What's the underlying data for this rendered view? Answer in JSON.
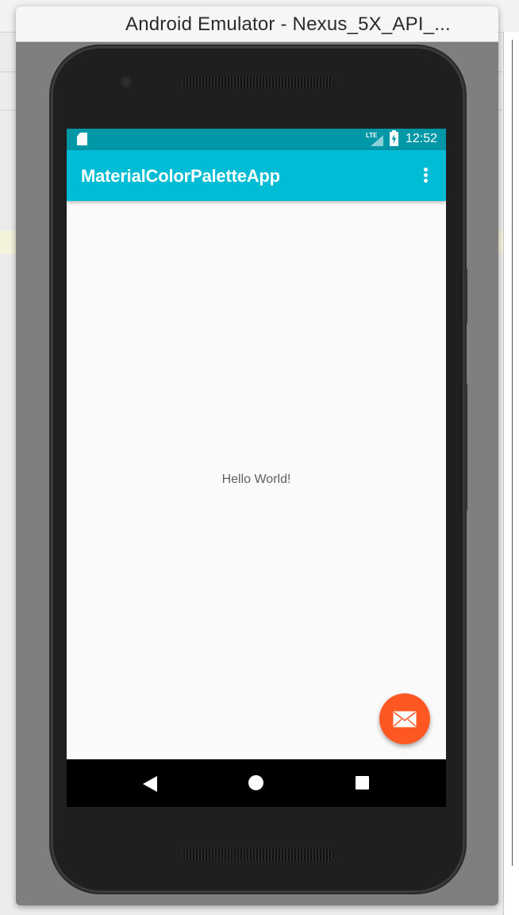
{
  "window": {
    "title": "Android Emulator - Nexus_5X_API_..."
  },
  "status_bar": {
    "network_label": "LTE",
    "time": "12:52",
    "icons": [
      "sd-card-icon",
      "lte-signal-icon",
      "battery-charging-icon"
    ]
  },
  "app_bar": {
    "title": "MaterialColorPaletteApp",
    "overflow_icon": "more-vert-icon"
  },
  "content": {
    "text": "Hello World!"
  },
  "fab": {
    "icon": "mail-icon",
    "color": "#ff5722"
  },
  "nav_bar": {
    "buttons": [
      "back-icon",
      "home-icon",
      "recents-icon"
    ]
  },
  "colors": {
    "primary": "#00bcd4",
    "primary_dark": "#0097a7",
    "accent": "#ff5722",
    "background": "#fafafa"
  }
}
